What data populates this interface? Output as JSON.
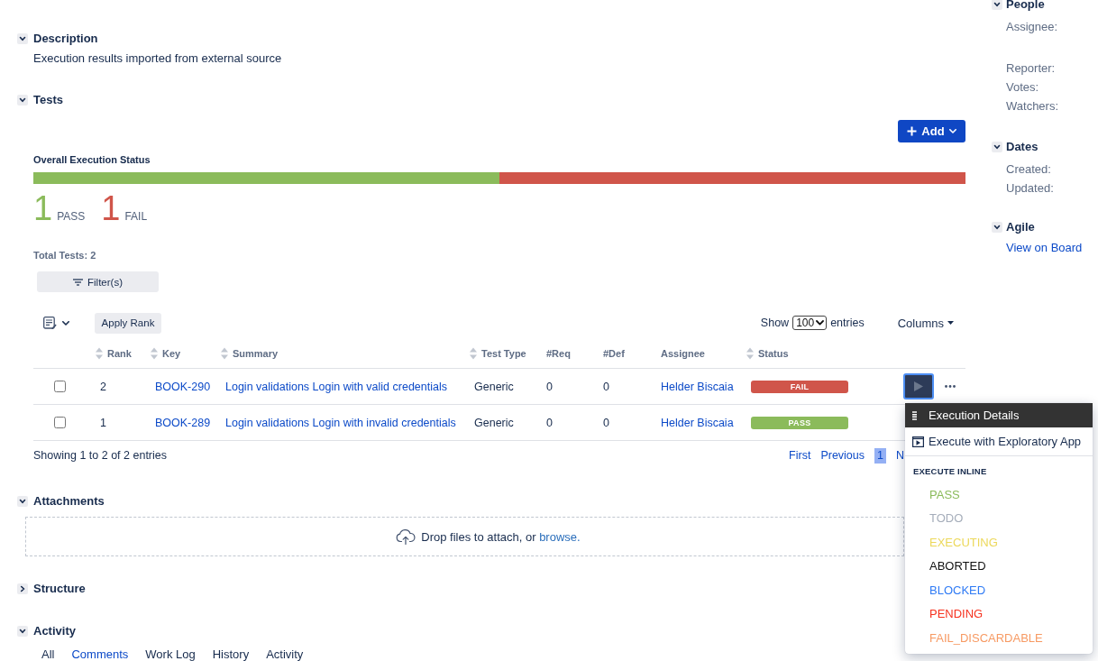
{
  "description": {
    "title": "Description",
    "expanded": true,
    "text": "Execution results imported from external source"
  },
  "tests": {
    "title": "Tests",
    "expanded": true,
    "add_button": "Add",
    "status_title": "Overall Execution Status",
    "segments": [
      {
        "level": 0.5,
        "color": "#8bbb5b"
      },
      {
        "level": 0.5,
        "color": "#d0554a"
      }
    ],
    "counts": [
      {
        "count": "1",
        "label": "PASS",
        "color": "#8bbb5b"
      },
      {
        "count": "1",
        "label": "FAIL",
        "color": "#d0554a"
      }
    ],
    "total": "Total Tests: 2",
    "filter_button": "Filter(s)",
    "apply_rank": "Apply Rank",
    "page_size": {
      "before": "Show",
      "value": "100",
      "after": "entries"
    },
    "columns_button": "Columns",
    "table": {
      "columns": [
        {
          "label": "Rank",
          "sortable": true
        },
        {
          "label": "Key",
          "sortable": true
        },
        {
          "label": "Summary",
          "sortable": true
        },
        {
          "label": "Test Type",
          "sortable": true
        },
        {
          "label": "#Req",
          "sortable": false
        },
        {
          "label": "#Def",
          "sortable": false
        },
        {
          "label": "Assignee",
          "sortable": false
        },
        {
          "label": "Status",
          "sortable": true
        }
      ],
      "rows": [
        {
          "checked": false,
          "rank": "2",
          "key": "BOOK-290",
          "summary": "Login validations Login with valid credentials",
          "test_type": "Generic",
          "req": "0",
          "def": "0",
          "assignee": "Helder Biscaia",
          "status": {
            "label": "FAIL",
            "color": "#d0554a"
          },
          "actions_visible": true
        },
        {
          "checked": false,
          "rank": "1",
          "key": "BOOK-289",
          "summary": "Login validations Login with invalid credentials",
          "test_type": "Generic",
          "req": "0",
          "def": "0",
          "assignee": "Helder Biscaia",
          "status": {
            "label": "PASS",
            "color": "#8bbb5b"
          },
          "actions_visible": false
        }
      ]
    },
    "showing": "Showing 1 to 2 of 2 entries",
    "pagination": [
      {
        "label": "First",
        "selected": false
      },
      {
        "label": "Previous",
        "selected": false
      },
      {
        "label": "1",
        "selected": true
      },
      {
        "label": "N",
        "selected": false
      }
    ]
  },
  "attachments": {
    "title": "Attachments",
    "expanded": true,
    "drop_text": "Drop files to attach, or",
    "browse_link": "browse."
  },
  "structure": {
    "title": "Structure",
    "expanded": false
  },
  "activity": {
    "title": "Activity",
    "expanded": true,
    "tabs": [
      {
        "label": "All",
        "selected": false
      },
      {
        "label": "Comments",
        "selected": true
      },
      {
        "label": "Work Log",
        "selected": false
      },
      {
        "label": "History",
        "selected": false
      },
      {
        "label": "Activity",
        "selected": false
      }
    ]
  },
  "sidebar": [
    {
      "title": "People",
      "expanded": true,
      "fields": [
        "Assignee:",
        "Reporter:",
        "Votes:",
        "Watchers:"
      ]
    },
    {
      "title": "Dates",
      "expanded": true,
      "fields": [
        "Created:",
        "Updated:"
      ]
    },
    {
      "title": "Agile",
      "expanded": true,
      "link": "View on Board"
    }
  ],
  "row_menu": {
    "actions": [
      {
        "label": "Execution Details",
        "selected": true
      },
      {
        "label": "Execute with Exploratory App",
        "selected": false
      }
    ],
    "section_title": "EXECUTE INLINE",
    "statuses": [
      {
        "label": "PASS",
        "color": "#8bbb5b"
      },
      {
        "label": "TODO",
        "color": "#a5adba"
      },
      {
        "label": "EXECUTING",
        "color": "#ecd85a"
      },
      {
        "label": "ABORTED",
        "color": "#111111"
      },
      {
        "label": "BLOCKED",
        "color": "#2f7bf5"
      },
      {
        "label": "PENDING",
        "color": "#f6321f"
      },
      {
        "label": "FAIL_DISCARDABLE",
        "color": "#f79a63"
      }
    ]
  }
}
